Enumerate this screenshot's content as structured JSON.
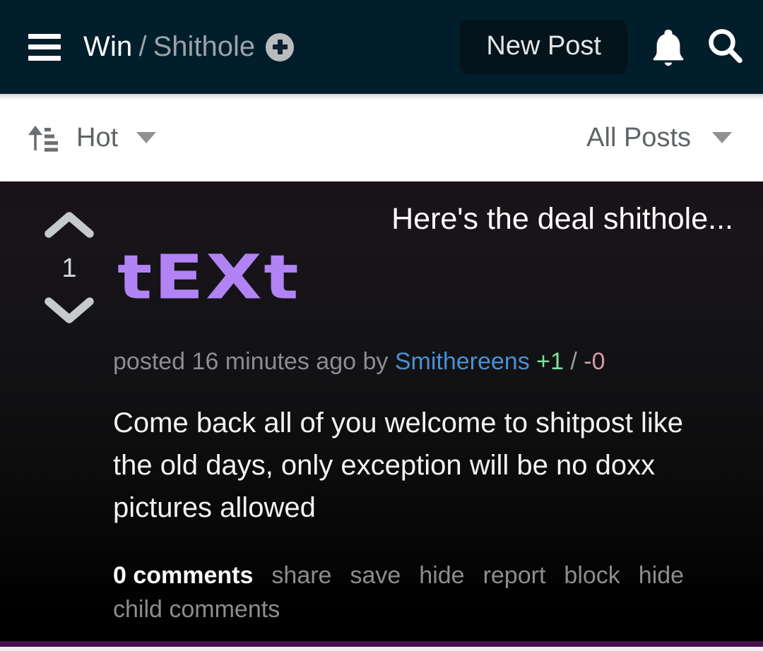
{
  "header": {
    "menu_icon": "hamburger-icon",
    "brand": "Win",
    "separator": "/",
    "community": "Shithole",
    "subscribe_icon": "plus-circle-icon",
    "new_post_label": "New Post",
    "notifications_icon": "bell-icon",
    "search_icon": "search-icon",
    "background_color": "#021E2B",
    "button_color": "#04131C"
  },
  "sortbar": {
    "sort_icon": "sort-ascending-icon",
    "sort_label": "Hot",
    "sort_caret_icon": "chevron-down-icon",
    "filter_label": "All Posts",
    "filter_caret_icon": "chevron-down-icon",
    "background_color": "#FFFFFF",
    "text_color": "#5E6366"
  },
  "post": {
    "upvote_icon": "chevron-up-icon",
    "downvote_icon": "chevron-down-icon",
    "score": "1",
    "title": "Here's the deal shithole...",
    "thumbnail_label": "tEXt",
    "thumbnail_color": "#B183F5",
    "meta": {
      "posted": "posted 16 minutes ago by",
      "author": "Smithereens",
      "upvotes": "+1",
      "slash": "/",
      "downvotes": "-0",
      "author_color": "#4B90D6",
      "upvote_color": "#7CE49A",
      "downvote_color": "#D79AA6"
    },
    "body": "Come back all of you welcome to shitpost like the old days, only exception will be no doxx pictures allowed",
    "actions": [
      {
        "label": "0 comments",
        "primary": true
      },
      {
        "label": "share",
        "primary": false
      },
      {
        "label": "save",
        "primary": false
      },
      {
        "label": "hide",
        "primary": false
      },
      {
        "label": "report",
        "primary": false
      },
      {
        "label": "block",
        "primary": false
      },
      {
        "label": "hide child comments",
        "primary": false
      }
    ]
  },
  "footer": {
    "accent_color": "#47104F"
  }
}
